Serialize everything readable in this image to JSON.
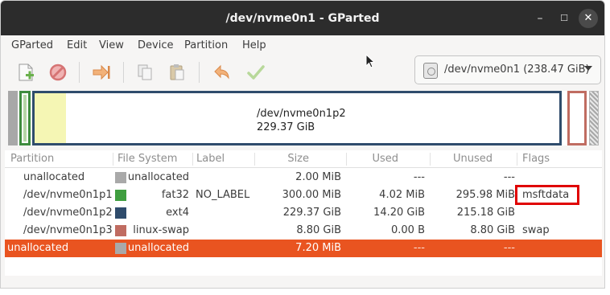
{
  "window": {
    "title": "/dev/nvme0n1 - GParted",
    "min_glyph": "–",
    "max_glyph": "☐",
    "close_glyph": "✕"
  },
  "menu": [
    "GParted",
    "Edit",
    "View",
    "Device",
    "Partition",
    "Help"
  ],
  "toolbar": {
    "icons": [
      "new-partition-icon",
      "delete-icon",
      "resize-move-icon",
      "copy-icon",
      "paste-icon",
      "undo-icon",
      "apply-icon"
    ],
    "device_selector": "/dev/nvme0n1 (238.47 GiB)"
  },
  "diskmap": {
    "selected_label": "/dev/nvme0n1p2",
    "selected_size": "229.37 GiB",
    "selected_used_fraction": 0.06
  },
  "table": {
    "columns": [
      "Partition",
      "File System",
      "Label",
      "Size",
      "Used",
      "Unused",
      "Flags"
    ],
    "rows": [
      {
        "partition": "unallocated",
        "fs": "unallocated",
        "label": "",
        "size": "2.00 MiB",
        "used": "---",
        "unused": "---",
        "flags": "",
        "color": "#a9a9a9"
      },
      {
        "partition": "/dev/nvme0n1p1",
        "fs": "fat32",
        "label": "NO_LABEL",
        "size": "300.00 MiB",
        "used": "4.02 MiB",
        "unused": "295.98 MiB",
        "flags": "msftdata",
        "color": "#3f9e3f"
      },
      {
        "partition": "/dev/nvme0n1p2",
        "fs": "ext4",
        "label": "",
        "size": "229.37 GiB",
        "used": "14.20 GiB",
        "unused": "215.18 GiB",
        "flags": "",
        "color": "#2f4c6c"
      },
      {
        "partition": "/dev/nvme0n1p3",
        "fs": "linux-swap",
        "label": "",
        "size": "8.80 GiB",
        "used": "0.00 B",
        "unused": "8.80 GiB",
        "flags": "swap",
        "color": "#c06c61"
      },
      {
        "partition": "unallocated",
        "fs": "unallocated",
        "label": "",
        "size": "7.20 MiB",
        "used": "---",
        "unused": "---",
        "flags": "",
        "color": "#a9a9a9"
      }
    ],
    "selected_row": 4
  },
  "colors": {
    "selection": "#e95420",
    "highlight_box": "#e00000"
  }
}
